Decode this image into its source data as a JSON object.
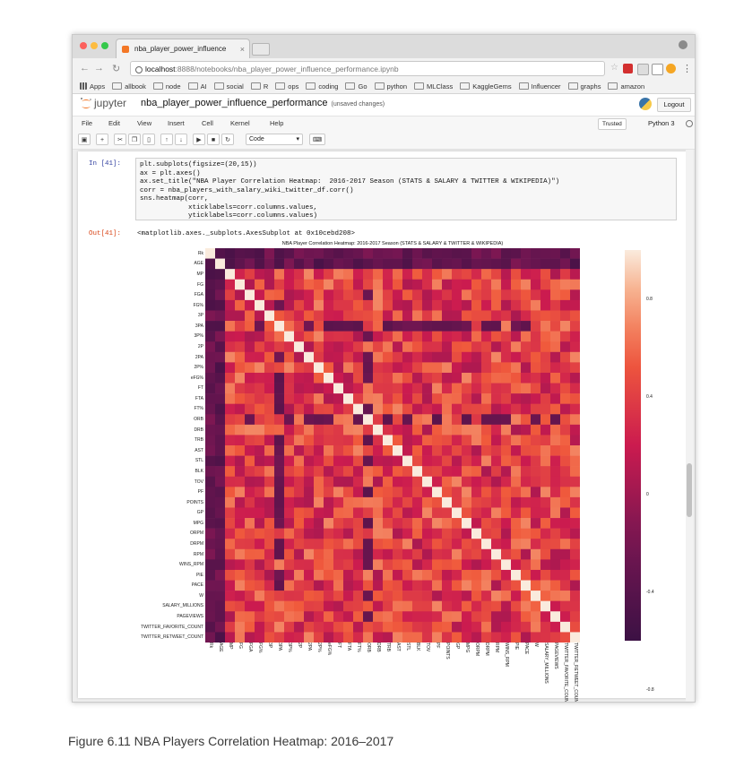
{
  "browser": {
    "tab_title": "nba_player_power_influence",
    "url_host": "localhost",
    "url_rest": ":8888/notebooks/nba_player_power_influence_performance.ipynb",
    "bookmarks": [
      "Apps",
      "allbook",
      "node",
      "AI",
      "social",
      "R",
      "ops",
      "coding",
      "Go",
      "python",
      "MLClass",
      "KaggleGems",
      "Influencer",
      "graphs",
      "amazon"
    ]
  },
  "jupyter": {
    "brand": "jupyter",
    "notebook_name": "nba_player_power_influence_performance",
    "save_status": "(unsaved changes)",
    "logout_label": "Logout",
    "menu": [
      "File",
      "Edit",
      "View",
      "Insert",
      "Cell",
      "Kernel",
      "Help"
    ],
    "trusted_label": "Trusted",
    "kernel_name": "Python 3",
    "cell_type": "Code"
  },
  "cell": {
    "in_prompt": "In [41]:",
    "code_lines": [
      "plt.subplots(figsize=(20,15))",
      "ax = plt.axes()",
      "ax.set_title(\"NBA Player Correlation Heatmap:  2016-2017 Season (STATS & SALARY & TWITTER & WIKIPEDIA)\")",
      "corr = nba_players_with_salary_wiki_twitter_df.corr()",
      "sns.heatmap(corr,",
      "            xticklabels=corr.columns.values,",
      "            yticklabels=corr.columns.values)"
    ],
    "out_prompt": "Out[41]:",
    "out_text": "<matplotlib.axes._subplots.AxesSubplot at 0x10cebd208>"
  },
  "chart_data": {
    "type": "heatmap",
    "title": "NBA Player Correlation Heatmap:  2016-2017 Season (STATS & SALARY & TWITTER & WIKIPEDIA)",
    "labels": [
      "Rk",
      "AGE",
      "MP",
      "FG",
      "FGA",
      "FG%",
      "3P",
      "3PA",
      "3P%",
      "2P",
      "2PA",
      "2P%",
      "eFG%",
      "FT",
      "FTA",
      "FT%",
      "ORB",
      "DRB",
      "TRB",
      "AST",
      "STL",
      "BLK",
      "TOV",
      "PF",
      "POINTS",
      "GP",
      "MPG",
      "ORPM",
      "DRPM",
      "RPM",
      "WINS_RPM",
      "PIE",
      "PACE",
      "W",
      "SALARY_MILLIONS",
      "PAGEVIEWS",
      "TWITTER_FAVORITE_COUNT",
      "TWITTER_RETWEET_COUNT"
    ],
    "colorbar": {
      "min": -0.6,
      "max": 1.0,
      "ticks": [
        0.8,
        0.4,
        0.0,
        -0.4,
        -0.8
      ],
      "palette": "rocket"
    }
  },
  "caption": "Figure 6.11   NBA Players Correlation Heatmap: 2016–2017",
  "colors": {
    "close": "#fc605c",
    "minimize": "#fdbc40",
    "zoom": "#34c84a",
    "jupyter_orange": "#f37726"
  }
}
